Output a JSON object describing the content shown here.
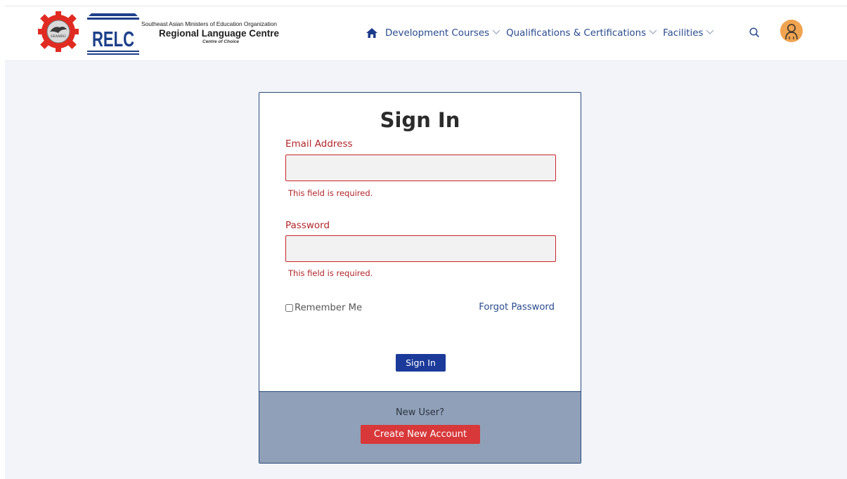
{
  "header": {
    "org_line1": "Southeast Asian Ministers of Education Organization",
    "org_line2": "Regional Language Centre",
    "org_line3": "Centre of Choice",
    "relc_text": "RELC",
    "seameo_text": "SEAMEO"
  },
  "nav": {
    "home_icon": "home-icon",
    "items": [
      {
        "label": "Development Courses",
        "icon": "chevron-down-icon"
      },
      {
        "label": "Qualifications & Certifications",
        "icon": "chevron-down-icon"
      },
      {
        "label": "Facilities",
        "icon": "chevron-down-icon"
      }
    ],
    "search_icon": "search-icon",
    "avatar_icon": "user-avatar-icon"
  },
  "signin": {
    "title": "Sign In",
    "email_label": "Email Address",
    "email_value": "",
    "email_error": "This field is required.",
    "password_label": "Password",
    "password_value": "",
    "password_error": "This field is required.",
    "remember_label": "Remember Me",
    "remember_checked": false,
    "forgot_label": "Forgot Password",
    "submit_label": "Sign In"
  },
  "footer": {
    "new_user_text": "New User?",
    "create_label": "Create New Account"
  },
  "colors": {
    "nav_link": "#2a4b8d",
    "error": "#b1262b",
    "primary_button": "#1b3a9a",
    "danger_button": "#d8383a",
    "footer_panel": "#8fa0b8",
    "avatar": "#f0a350"
  }
}
